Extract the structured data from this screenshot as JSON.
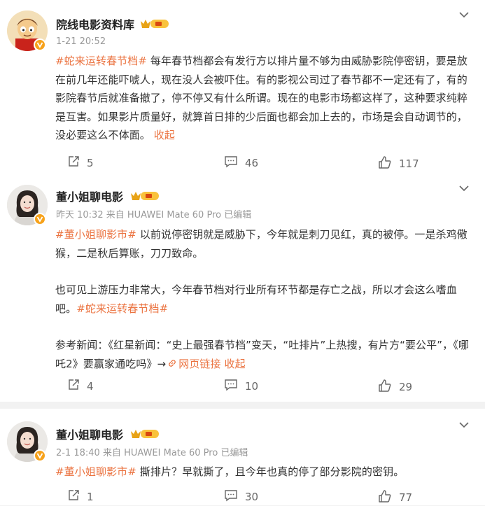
{
  "posts": [
    {
      "author": "院线电影资料库",
      "meta": "1-21 20:52",
      "tag": "#蛇来运转春节档#",
      "text": " 每年春节档都会有发行方以排片量不够为由威胁影院停密钥，要是放在前几年还能吓唬人，现在没人会被吓住。有的影视公司过了春节都不一定还有了，有的影院春节后就准备撤了，停不停又有什么所谓。现在的电影市场都这样了，这种要求纯粹是互害。如果影片质量好，就算首日排的少后面也都会加上去的，市场是会自动调节的，没必要这么不体面。 ",
      "collapse": "收起",
      "reposts": "5",
      "comments": "46",
      "likes": "117"
    },
    {
      "author": "董小姐聊电影",
      "meta": "昨天 10:32 来自 HUAWEI Mate 60 Pro 已编辑",
      "tag": "#董小姐聊影市#",
      "text1": " 以前说停密钥就是威胁下，今年就是刺刀见红，真的被停。一是杀鸡儆猴，二是秋后算账，刀刀致命。",
      "text2": "也可见上游压力非常大，今年春节档对行业所有环节都是存亡之战，所以才会这么嗜血吧。",
      "tag2": "#蛇来运转春节档#",
      "ref": "参考新闻：《红星新闻：“史上最强春节档”变天，“吐排片”上热搜，有片方“要公平”，《哪吒2》要赢家通吃吗》→",
      "link": "网页链接",
      "collapse": "收起",
      "reposts": "4",
      "comments": "10",
      "likes": "29"
    },
    {
      "author": "董小姐聊电影",
      "meta": "2-1 18:40 来自 HUAWEI Mate 60 Pro 已编辑",
      "tag": "#董小姐聊影市#",
      "text": " 撕排片？早就撕了，且今年也真的停了部分影院的密钥。",
      "reposts": "1",
      "comments": "30",
      "likes": "77"
    }
  ],
  "colors": {
    "accent": "#eb7340",
    "badge": "#f7a21b",
    "divider": "#f2f2f2"
  },
  "icons": [
    "chevron-down-icon",
    "repost-icon",
    "comment-icon",
    "like-icon",
    "verified-icon",
    "fan-badge-icon",
    "link-icon"
  ]
}
